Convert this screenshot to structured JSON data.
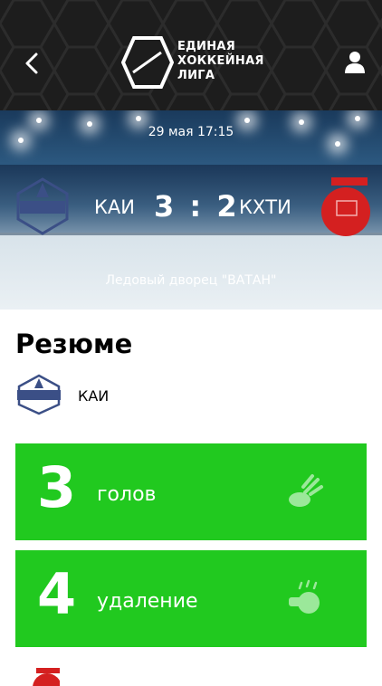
{
  "header": {
    "logo_mark": "ЕХЛ",
    "logo_line1": "ЕДИНАЯ",
    "logo_line2": "ХОККЕЙНАЯ",
    "logo_line3": "ЛИГА"
  },
  "match": {
    "datetime": "29 мая 17:15",
    "home_team": "КАИ",
    "away_team": "КХТИ",
    "home_score": "3",
    "away_score": "2",
    "score_separator": ":",
    "venue": "Ледовый дворец \"ВАТАН\""
  },
  "summary": {
    "title": "Резюме",
    "team_name": "КАИ",
    "stats": [
      {
        "value": "3",
        "label": "голов",
        "icon": "puck-icon"
      },
      {
        "value": "4",
        "label": "удаление",
        "icon": "whistle-icon"
      }
    ]
  },
  "colors": {
    "header_bg": "#1d1d1d",
    "stat_green": "#21c91f",
    "away_red": "#d42020"
  }
}
